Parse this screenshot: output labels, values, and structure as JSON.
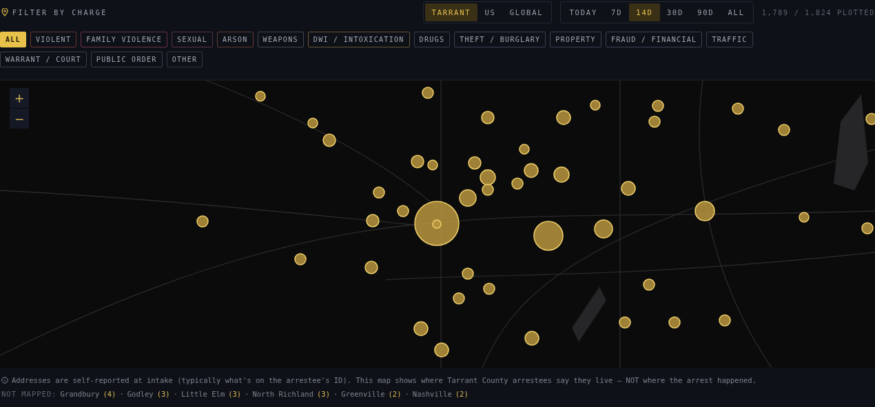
{
  "header": {
    "title": "FILTER BY CHARGE",
    "scope_tabs": [
      {
        "label": "TARRANT",
        "selected": true
      },
      {
        "label": "US",
        "selected": false
      },
      {
        "label": "GLOBAL",
        "selected": false
      }
    ],
    "range_tabs": [
      {
        "label": "TODAY",
        "selected": false
      },
      {
        "label": "7D",
        "selected": false
      },
      {
        "label": "14D",
        "selected": true
      },
      {
        "label": "30D",
        "selected": false
      },
      {
        "label": "90D",
        "selected": false
      },
      {
        "label": "ALL",
        "selected": false
      }
    ],
    "plotted": "1,789 / 1,824 PLOTTED"
  },
  "charges": [
    {
      "label": "ALL",
      "selected": true,
      "color": "#e8c14a"
    },
    {
      "label": "VIOLENT",
      "selected": false,
      "color": "#6b3238"
    },
    {
      "label": "FAMILY VIOLENCE",
      "selected": false,
      "color": "#6b3242"
    },
    {
      "label": "SEXUAL",
      "selected": false,
      "color": "#5c3240"
    },
    {
      "label": "ARSON",
      "selected": false,
      "color": "#5e3a30"
    },
    {
      "label": "WEAPONS",
      "selected": false,
      "color": "#43464e"
    },
    {
      "label": "DWI / INTOXICATION",
      "selected": false,
      "color": "#6a5530"
    },
    {
      "label": "DRUGS",
      "selected": false,
      "color": "#363d4c"
    },
    {
      "label": "THEFT / BURGLARY",
      "selected": false,
      "color": "#384256"
    },
    {
      "label": "PROPERTY",
      "selected": false,
      "color": "#384256"
    },
    {
      "label": "FRAUD / FINANCIAL",
      "selected": false,
      "color": "#384256"
    },
    {
      "label": "TRAFFIC",
      "selected": false,
      "color": "#363d4c"
    },
    {
      "label": "WARRANT / COURT",
      "selected": false,
      "color": "#3a3f4a"
    },
    {
      "label": "PUBLIC ORDER",
      "selected": false,
      "color": "#3a3f4a"
    },
    {
      "label": "OTHER",
      "selected": false,
      "color": "#33373f"
    }
  ],
  "map": {
    "zoom_in": "+",
    "zoom_out": "−"
  },
  "notice": "Addresses are self-reported at intake (typically what's on the arrestee's ID). This map shows where Tarrant County arrestees say they live — NOT where the arrest happened.",
  "not_mapped": {
    "label": "NOT MAPPED:",
    "separator": "·",
    "items": [
      {
        "name": "Grandbury",
        "count": "(4)"
      },
      {
        "name": "Godley",
        "count": "(3)"
      },
      {
        "name": "Little Elm",
        "count": "(3)"
      },
      {
        "name": "North Richland",
        "count": "(3)"
      },
      {
        "name": "Greenville",
        "count": "(2)"
      },
      {
        "name": "Nashville",
        "count": "(2)"
      }
    ]
  }
}
